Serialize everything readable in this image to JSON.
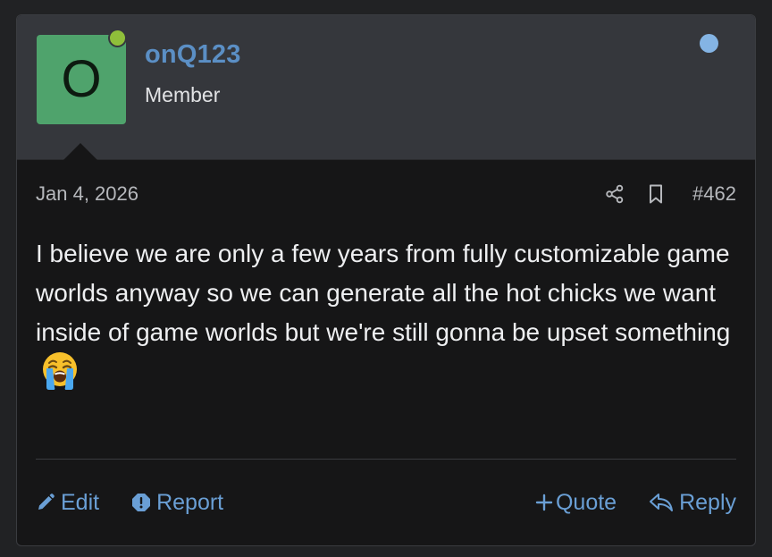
{
  "author": {
    "avatar_letter": "O",
    "avatar_color": "#4fa36c",
    "online_color": "#8fbf3a",
    "username": "onQ123",
    "user_title": "Member"
  },
  "unread_indicator_color": "#84b4e4",
  "meta": {
    "date": "Jan 4, 2026",
    "share_icon": "share-icon",
    "bookmark_icon": "bookmark-icon",
    "post_number": "#462"
  },
  "body": {
    "text": "I believe we are only a few years from fully customizable game worlds anyway so we can generate all the hot chicks we want inside of game worlds but we're still gonna be upset something",
    "emoji": "loudly-crying-face"
  },
  "actions": {
    "edit_label": "Edit",
    "report_label": "Report",
    "quote_label": "Quote",
    "reply_label": "Reply"
  },
  "colors": {
    "link": "#6a9fd5",
    "username": "#5b8fc5",
    "header_bg": "#35373c",
    "post_bg": "#161617"
  }
}
